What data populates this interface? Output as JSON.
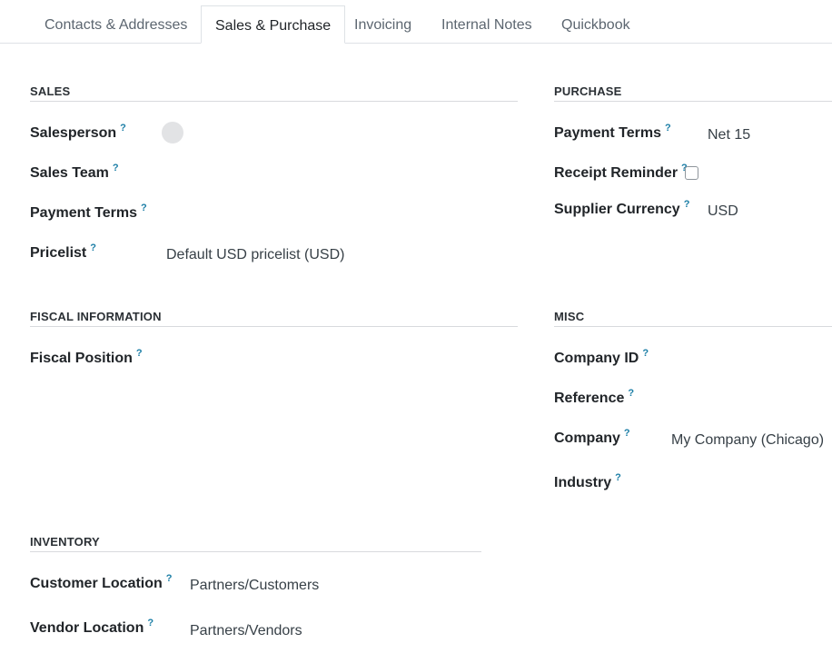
{
  "tabs": {
    "contacts": "Contacts & Addresses",
    "sales_purchase": "Sales & Purchase",
    "invoicing": "Invoicing",
    "internal_notes": "Internal Notes",
    "quickbook": "Quickbook"
  },
  "help_mark": "?",
  "sales": {
    "title": "SALES",
    "salesperson_label": "Salesperson",
    "sales_team_label": "Sales Team",
    "payment_terms_label": "Payment Terms",
    "pricelist_label": "Pricelist",
    "pricelist_value": "Default USD pricelist (USD)"
  },
  "purchase": {
    "title": "PURCHASE",
    "payment_terms_label": "Payment Terms",
    "payment_terms_value": "Net 15",
    "receipt_reminder_label": "Receipt Reminder",
    "supplier_currency_label": "Supplier Currency",
    "supplier_currency_value": "USD"
  },
  "fiscal": {
    "title": "FISCAL INFORMATION",
    "fiscal_position_label": "Fiscal Position"
  },
  "misc": {
    "title": "MISC",
    "company_id_label": "Company ID",
    "reference_label": "Reference",
    "company_label": "Company",
    "company_value": "My Company (Chicago)",
    "industry_label": "Industry"
  },
  "inventory": {
    "title": "INVENTORY",
    "customer_location_label": "Customer Location",
    "customer_location_value": "Partners/Customers",
    "vendor_location_label": "Vendor Location",
    "vendor_location_value": "Partners/Vendors"
  }
}
